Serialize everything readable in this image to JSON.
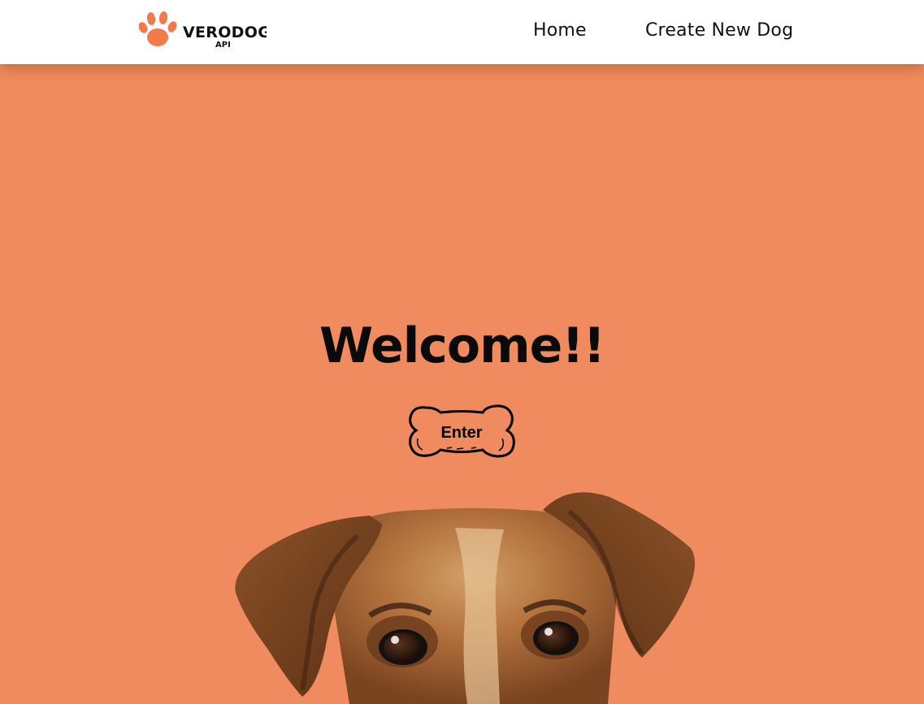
{
  "navbar": {
    "logo": {
      "title": "VERODOGS",
      "subtitle": "API",
      "icon": "paw-icon",
      "color": "#f47a4a"
    },
    "links": [
      {
        "label": "Home"
      },
      {
        "label": "Create New Dog"
      }
    ]
  },
  "hero": {
    "title": "Welcome!!",
    "enter_label": "Enter",
    "button_icon": "bone-icon",
    "image": "dog-peeking"
  },
  "colors": {
    "background": "#ef8b5e",
    "navbar": "#ffffff",
    "text": "#111111",
    "logo_accent": "#f47a4a"
  }
}
